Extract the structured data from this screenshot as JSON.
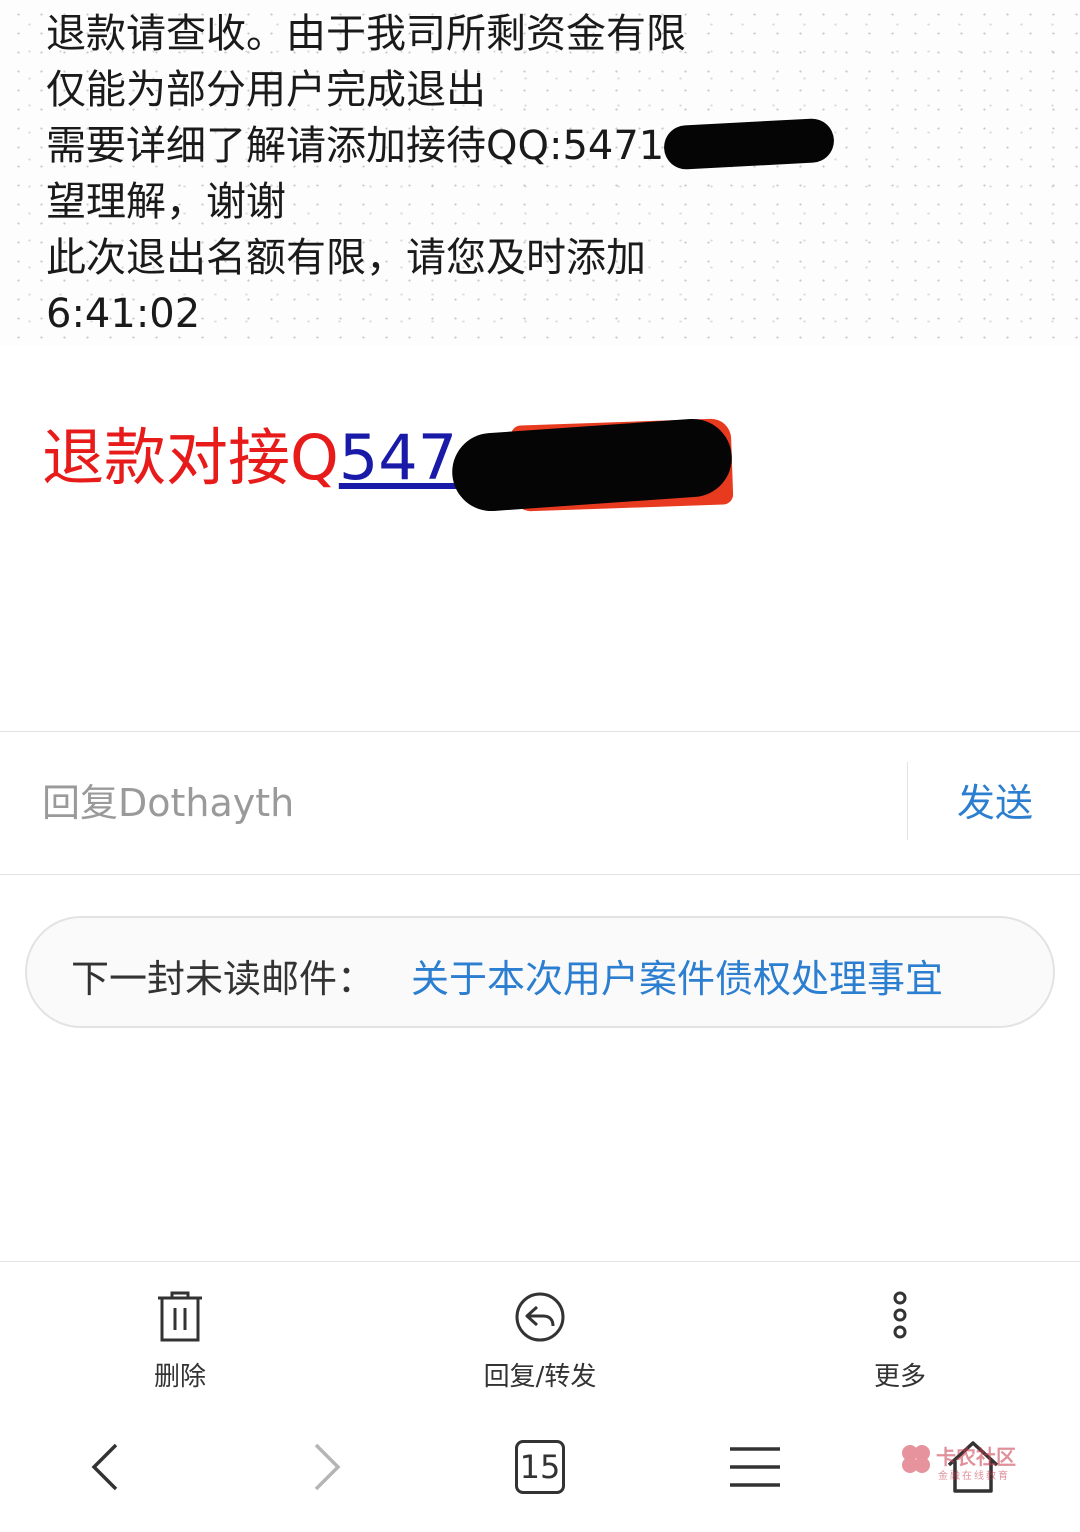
{
  "message": {
    "lines": [
      "退款请查收。由于我司所剩资金有限",
      "仅能为部分用户完成退出",
      "需要详细了解请添加接待QQ:5471",
      "望理解，谢谢",
      "此次退出名额有限，请您及时添加",
      "6:41:02"
    ],
    "refund_prefix": "退款对接Q",
    "refund_link": "547"
  },
  "reply": {
    "placeholder": "回复Dothayth",
    "send_label": "发送"
  },
  "next_unread": {
    "label": "下一封未读邮件：",
    "subject": "关于本次用户案件债权处理事宜"
  },
  "actions": {
    "delete_label": "删除",
    "reply_forward_label": "回复/转发",
    "more_label": "更多"
  },
  "nav": {
    "tab_count": "15"
  },
  "watermark": {
    "title": "卡农社区",
    "subtitle": "金融在线教育"
  },
  "colors": {
    "link_blue": "#2b7ed0",
    "refund_red": "#e81b1b",
    "refund_link": "#1a1aa8"
  }
}
